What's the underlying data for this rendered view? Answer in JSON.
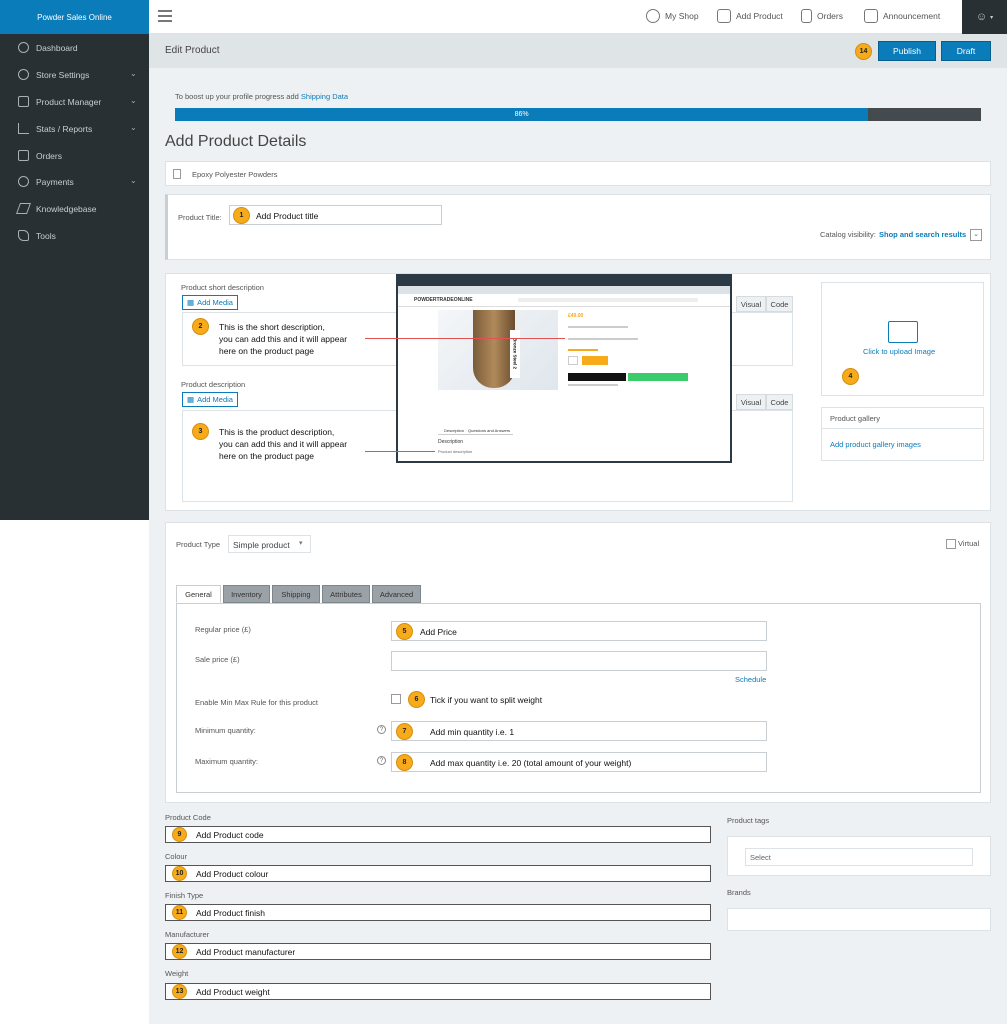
{
  "brand": "Powder Sales Online",
  "topnav": [
    {
      "label": "My Shop",
      "icon": "globe-icon"
    },
    {
      "label": "Add Product",
      "icon": "box-icon"
    },
    {
      "label": "Orders",
      "icon": "document-icon"
    },
    {
      "label": "Announcement",
      "icon": "megaphone-icon"
    }
  ],
  "sidebar": {
    "items": [
      {
        "label": "Dashboard"
      },
      {
        "label": "Store Settings"
      },
      {
        "label": "Product Manager"
      },
      {
        "label": "Stats / Reports"
      },
      {
        "label": "Orders"
      },
      {
        "label": "Payments"
      },
      {
        "label": "Knowledgebase"
      },
      {
        "label": "Tools"
      }
    ]
  },
  "header": {
    "title": "Edit Product",
    "publish": "Publish",
    "draft": "Draft",
    "badge": "14"
  },
  "progress": {
    "text": "To boost up your profile progress add",
    "link": "Shipping Data",
    "percent_label": "86%",
    "value": 0.86
  },
  "page_title": "Add Product Details",
  "category": "Epoxy Polyester Powders",
  "title_field": {
    "label": "Product Title:",
    "value": "Add Product title",
    "badge": "1"
  },
  "catalog": {
    "label": "Catalog visibility:",
    "value": "Shop and search results"
  },
  "short_desc": {
    "label": "Product short description",
    "add_media": "Add Media",
    "badge": "2",
    "line1": "This is the short description,",
    "line2": "you can add this and it will appear",
    "line3": "here on the product page"
  },
  "desc": {
    "label": "Product description",
    "add_media": "Add Media",
    "badge": "3",
    "line1": "This is the product description,",
    "line2": "you can add this and it will appear",
    "line3": "here on the product page"
  },
  "editor_tabs": {
    "visual": "Visual",
    "code": "Code"
  },
  "image": {
    "label": "Click to upload Image",
    "badge": "4"
  },
  "gallery": {
    "title": "Product gallery",
    "link": "Add product gallery images"
  },
  "embedded": {
    "logo": "POWDERTRADEONLINE",
    "stamp": "Bronze Steel 2",
    "price": "£49.00",
    "desc_tab": "Description",
    "qa_tab": "Questions and Answers",
    "desc_heading": "Description",
    "desc_text": "Product description"
  },
  "product_type": {
    "label": "Product Type",
    "value": "Simple product",
    "virtual": "Virtual"
  },
  "tabs": [
    "General",
    "Inventory",
    "Shipping",
    "Attributes",
    "Advanced"
  ],
  "general": {
    "regular_price": {
      "label": "Regular price (£)",
      "value": "Add Price",
      "badge": "5"
    },
    "sale_price": {
      "label": "Sale price (£)",
      "schedule": "Schedule"
    },
    "minmax": {
      "label": "Enable Min Max Rule for this product",
      "text": "Tick if you want to split weight",
      "badge": "6"
    },
    "min_qty": {
      "label": "Minimum quantity:",
      "value": "Add min quantity i.e. 1",
      "badge": "7"
    },
    "max_qty": {
      "label": "Maximum quantity:",
      "value": "Add max quantity i.e. 20 (total amount of your weight)",
      "badge": "8"
    }
  },
  "attrs": [
    {
      "label": "Product Code",
      "value": "Add Product code",
      "badge": "9"
    },
    {
      "label": "Colour",
      "value": "Add Product colour",
      "badge": "10"
    },
    {
      "label": "Finish Type",
      "value": "Add Product finish",
      "badge": "11"
    },
    {
      "label": "Manufacturer",
      "value": "Add Product manufacturer",
      "badge": "12"
    },
    {
      "label": "Weight",
      "value": "Add Product weight",
      "badge": "13"
    }
  ],
  "tags": {
    "label": "Product tags",
    "placeholder": "Select"
  },
  "brands": {
    "label": "Brands"
  }
}
